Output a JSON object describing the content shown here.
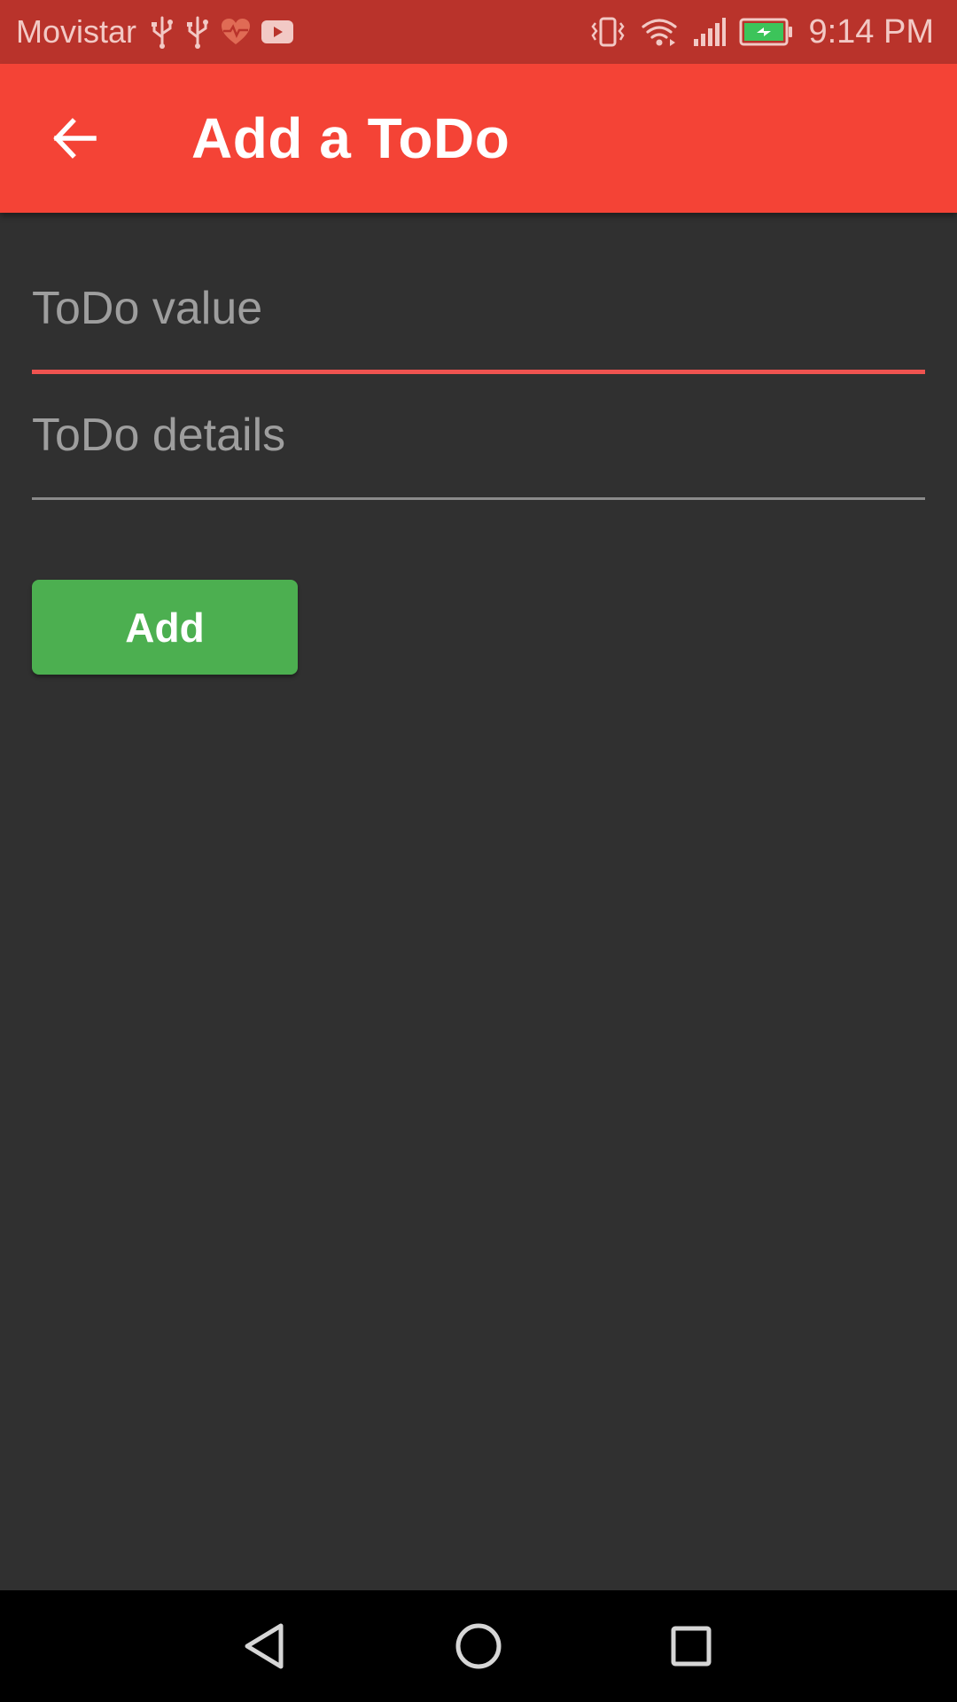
{
  "status_bar": {
    "carrier": "Movistar",
    "time": "9:14 PM",
    "left_icons": [
      "usb-icon",
      "usb-icon",
      "health-icon",
      "youtube-icon"
    ],
    "right_icons": [
      "vibrate-icon",
      "wifi-icon",
      "signal-icon",
      "battery-charging-icon"
    ]
  },
  "app_bar": {
    "title": "Add a ToDo",
    "back_icon": "arrow-back-icon"
  },
  "form": {
    "value_field": {
      "placeholder": "ToDo value",
      "value": ""
    },
    "details_field": {
      "placeholder": "ToDo details",
      "value": ""
    },
    "add_label": "Add"
  },
  "nav_bar": {
    "icons": [
      "back-triangle-icon",
      "home-circle-icon",
      "recents-square-icon"
    ]
  },
  "colors": {
    "status_bar": "#b9332b",
    "app_bar": "#f44336",
    "background": "#303030",
    "active_underline": "#ef5350",
    "add_button": "#4caf50",
    "nav_bar": "#000000"
  }
}
